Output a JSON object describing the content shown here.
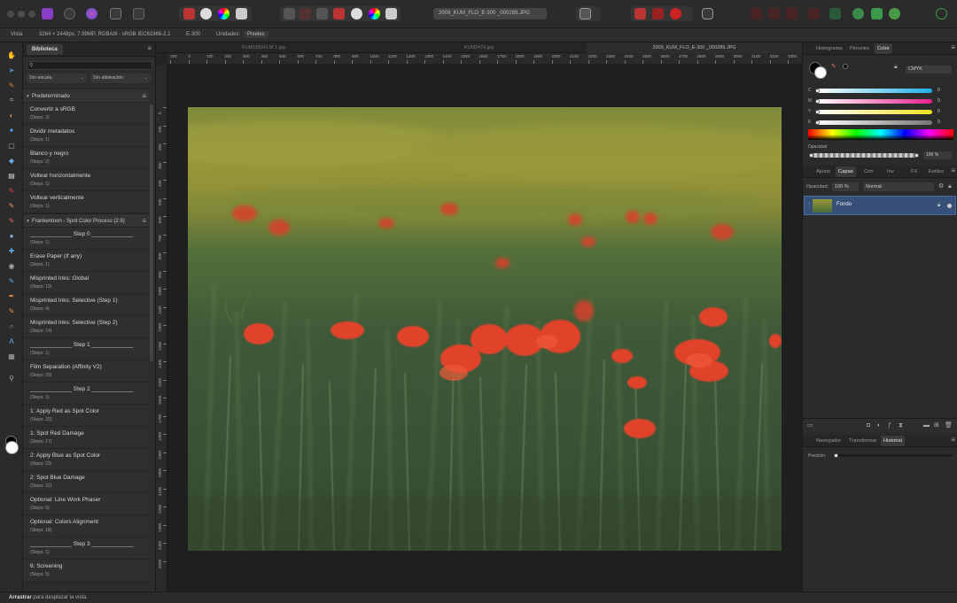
{
  "toolbar": {
    "document_title": "2009_KUM_FLO_E-300        _000289.JPG",
    "personas": [
      "photo-persona-icon",
      "liquify-persona-icon",
      "develop-persona-icon",
      "tone-mapping-persona-icon",
      "export-persona-icon"
    ]
  },
  "context": {
    "view_label": "Vista",
    "doc_info": "3264 × 2448px, 7.99MP, RGBA/8 - sRGB IEC61966-2.1",
    "camera": "E-300",
    "units_label": "Unidades:",
    "units_value": "Píxeles"
  },
  "library": {
    "tab": "Biblioteca",
    "search_placeholder": "",
    "scale_option": "Sin escala",
    "align_option": "Sin alineación",
    "groups": [
      {
        "name": "Predeterminado",
        "items": [
          {
            "title": "Convertir a sRGB",
            "steps": "(Steps: 2)"
          },
          {
            "title": "Dividir metadatos",
            "steps": "(Steps: 1)"
          },
          {
            "title": "Blanco y negro",
            "steps": "(Steps: 2)"
          },
          {
            "title": "Voltear horizontalmente",
            "steps": "(Steps: 1)"
          },
          {
            "title": "Voltear verticalmente",
            "steps": "(Steps: 1)"
          }
        ]
      },
      {
        "name": "Frankentoon - Spot Color Process (2.9)",
        "items": [
          {
            "title": "_____________ Step 0 _____________",
            "steps": "(Steps: 1)"
          },
          {
            "title": "Erase Paper (If any)",
            "steps": "(Steps: 1)"
          },
          {
            "title": "Misprinted Inks: Global",
            "steps": "(Steps: 19)"
          },
          {
            "title": "Misprinted Inks: Selective (Step 1)",
            "steps": "(Steps: 4)"
          },
          {
            "title": "Misprinted Inks: Selective (Step 2)",
            "steps": "(Steps: 14)"
          },
          {
            "title": "_____________ Step 1 _____________",
            "steps": "(Steps: 1)"
          },
          {
            "title": "Film Separation (Affinity V2)",
            "steps": "(Steps: 33)"
          },
          {
            "title": "_____________ Step 2 _____________",
            "steps": "(Steps: 1)"
          },
          {
            "title": "1: Apply Red as Spot Color",
            "steps": "(Steps: 23)"
          },
          {
            "title": "1: Spot Red Damage",
            "steps": "(Steps: 17)"
          },
          {
            "title": "2: Apply Blue as Spot Color",
            "steps": "(Steps: 23)"
          },
          {
            "title": "2: Spot Blue Damage",
            "steps": "(Steps: 22)"
          },
          {
            "title": "Optional: Line Work Phaser",
            "steps": "(Steps: 5)"
          },
          {
            "title": "Optional: Colors Alignment",
            "steps": "(Steps: 18)"
          },
          {
            "title": "_____________ Step 3 _____________",
            "steps": "(Steps: 1)"
          },
          {
            "title": "6: Screening",
            "steps": "(Steps: 5)"
          }
        ]
      }
    ]
  },
  "canvas": {
    "tabs": [
      "KUM1965FLM 1.jpg",
      "KUM2476.jpg",
      "2009_KUM_FLO_E-300        _000289.JPG"
    ],
    "hruler": [
      "100",
      "0",
      "100",
      "200",
      "300",
      "400",
      "500",
      "600",
      "700",
      "800",
      "900",
      "1000",
      "1100",
      "1200",
      "1300",
      "1400",
      "1500",
      "1600",
      "1700",
      "1800",
      "1900",
      "2000",
      "2100",
      "2200",
      "2300",
      "2400",
      "2500",
      "2600",
      "2700",
      "2800",
      "2900",
      "3000",
      "3100",
      "3200",
      "3300"
    ],
    "vruler": [
      "0",
      "100",
      "200",
      "300",
      "400",
      "500",
      "600",
      "700",
      "800",
      "900",
      "1000",
      "1100",
      "1200",
      "1300",
      "1400",
      "1500",
      "1600",
      "1700",
      "1800",
      "1900",
      "2000",
      "2100",
      "2200",
      "2300",
      "2400",
      "2500"
    ]
  },
  "right": {
    "color_tabs": [
      "Histograma",
      "Pinceles",
      "Color"
    ],
    "color_mode": "CMYK",
    "channels": [
      {
        "label": "C",
        "value": "0",
        "color": "#20b0e8"
      },
      {
        "label": "M",
        "value": "0",
        "color": "#e8208c"
      },
      {
        "label": "Y",
        "value": "0",
        "color": "#f0e020"
      },
      {
        "label": "K",
        "value": "0",
        "color": "#777777"
      }
    ],
    "opacity_label": "Opacidad",
    "opacity_value": "100 %",
    "layer_tabs": [
      "Ajuste",
      "Capas",
      "Con",
      "Inv",
      "FX",
      "Estilos"
    ],
    "layer_opacity_label": "Opacidad:",
    "layer_opacity_value": "100 %",
    "blend_mode": "Normal",
    "layer_name": "Fondo",
    "history_tabs": [
      "Navegador",
      "Transformar",
      "Historial"
    ],
    "position_label": "Posición:"
  },
  "status": {
    "bold": "Arrastrar",
    "text": " para desplazar la vista."
  }
}
